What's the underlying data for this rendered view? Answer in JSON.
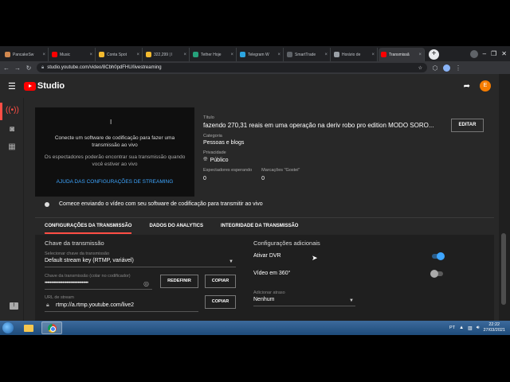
{
  "browser": {
    "tabs": [
      {
        "label": "PancakeSw",
        "color": "#d1884f"
      },
      {
        "label": "Music",
        "color": "#ff0000"
      },
      {
        "label": "Conta Spot",
        "color": "#f3ba2f"
      },
      {
        "label": "322,299 | l",
        "color": "#f3ba2f"
      },
      {
        "label": "Tether Hoje",
        "color": "#26a17b"
      },
      {
        "label": "Telegram W",
        "color": "#2ca5e0"
      },
      {
        "label": "SmartTrade",
        "color": "#5f6368"
      },
      {
        "label": "Horário de",
        "color": "#9aa0a6"
      },
      {
        "label": "Transmissã",
        "color": "#ff0000",
        "active": true
      }
    ],
    "new_tab": "+",
    "url": "studio.youtube.com/video/8Cbh0pdFHU/livestreaming"
  },
  "studio": {
    "logo_text": "Studio",
    "user_initial": "E",
    "preview": {
      "cursor": "I",
      "message": "Conecte um software de codificação para fazer uma transmissão ao vivo",
      "sub_message": "Os espectadores poderão encontrar sua transmissão quando você estiver ao vivo",
      "help_link": "AJUDA DAS CONFIGURAÇÕES DE STREAMING"
    },
    "details": {
      "title_label": "Título",
      "title": "fazendo 270,31 reais em uma operação na deriv robo pro edition MODO SORO...",
      "category_label": "Categoria",
      "category": "Pessoas e blogs",
      "privacy_label": "Privacidade",
      "privacy": "Público",
      "waiting_label": "Espectadores esperando",
      "waiting": "0",
      "likes_label": "Marcações \"Gostei\"",
      "likes": "0",
      "edit_label": "EDITAR"
    },
    "start_hint": "Comece enviando o vídeo com seu software de codificação para transmitir ao vivo",
    "tabs": [
      {
        "label": "CONFIGURAÇÕES DA TRANSMISSÃO",
        "active": true
      },
      {
        "label": "DADOS DO ANALYTICS"
      },
      {
        "label": "INTEGRIDADE DA TRANSMISSÃO"
      }
    ],
    "stream_key": {
      "section_title": "Chave da transmissão",
      "select_label": "Selecionar chave da transmissão",
      "select_value": "Default stream key (RTMP, variável)",
      "key_label": "Chave da transmissão (colar no codificador)",
      "key_value": "••••••••••••••••••••••••••••••••••",
      "reset_label": "REDEFINIR",
      "copy_label": "COPIAR",
      "url_label": "URL de stream",
      "url_value": "rtmp://a.rtmp.youtube.com/live2",
      "copy_url_label": "COPIAR"
    },
    "additional": {
      "section_title": "Configurações adicionais",
      "dvr_label": "Ativar DVR",
      "dvr_on": true,
      "video360_label": "Vídeo em 360°",
      "video360_on": false,
      "delay_label": "Adicionar atraso",
      "delay_value": "Nenhum"
    }
  },
  "taskbar": {
    "lang": "PT",
    "time": "22:22",
    "date": "27/03/2021"
  },
  "colors": {
    "accent_red": "#ff4e45",
    "link_blue": "#3ea6ff",
    "studio_bg": "#282828"
  }
}
